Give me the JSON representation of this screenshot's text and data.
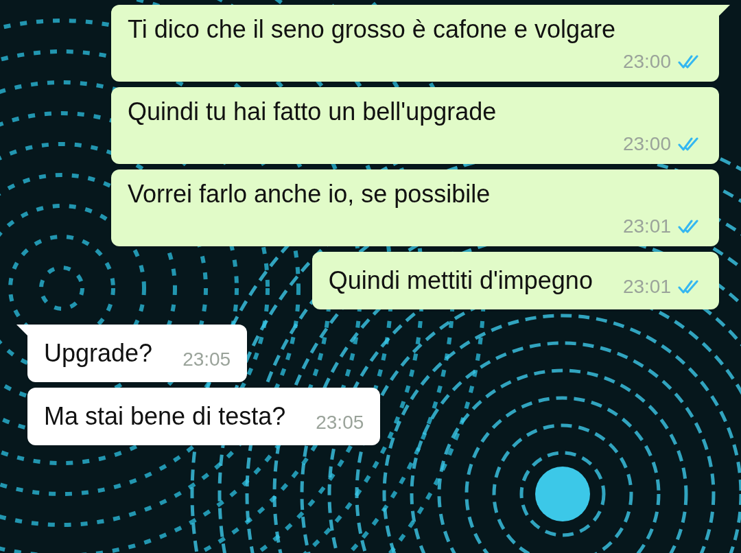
{
  "messages": [
    {
      "outgoing": true,
      "kind": "stacked",
      "tail": true,
      "text": "Ti dico che il seno grosso è cafone e volgare",
      "time": "23:00",
      "read": true
    },
    {
      "outgoing": true,
      "kind": "stacked",
      "tail": false,
      "text": "Quindi tu hai fatto un bell'upgrade",
      "time": "23:00",
      "read": true
    },
    {
      "outgoing": true,
      "kind": "stacked",
      "tail": false,
      "text": "Vorrei farlo anche io, se possibile",
      "time": "23:01",
      "read": true
    },
    {
      "outgoing": true,
      "kind": "inline",
      "tail": false,
      "text": "Quindi mettiti d'impegno",
      "time": "23:01",
      "read": true
    },
    {
      "outgoing": false,
      "kind": "inline",
      "tail": true,
      "text": "Upgrade?",
      "time": "23:05"
    },
    {
      "outgoing": false,
      "kind": "inline",
      "tail": false,
      "text": "Ma stai bene di testa?",
      "time": "23:05"
    }
  ]
}
